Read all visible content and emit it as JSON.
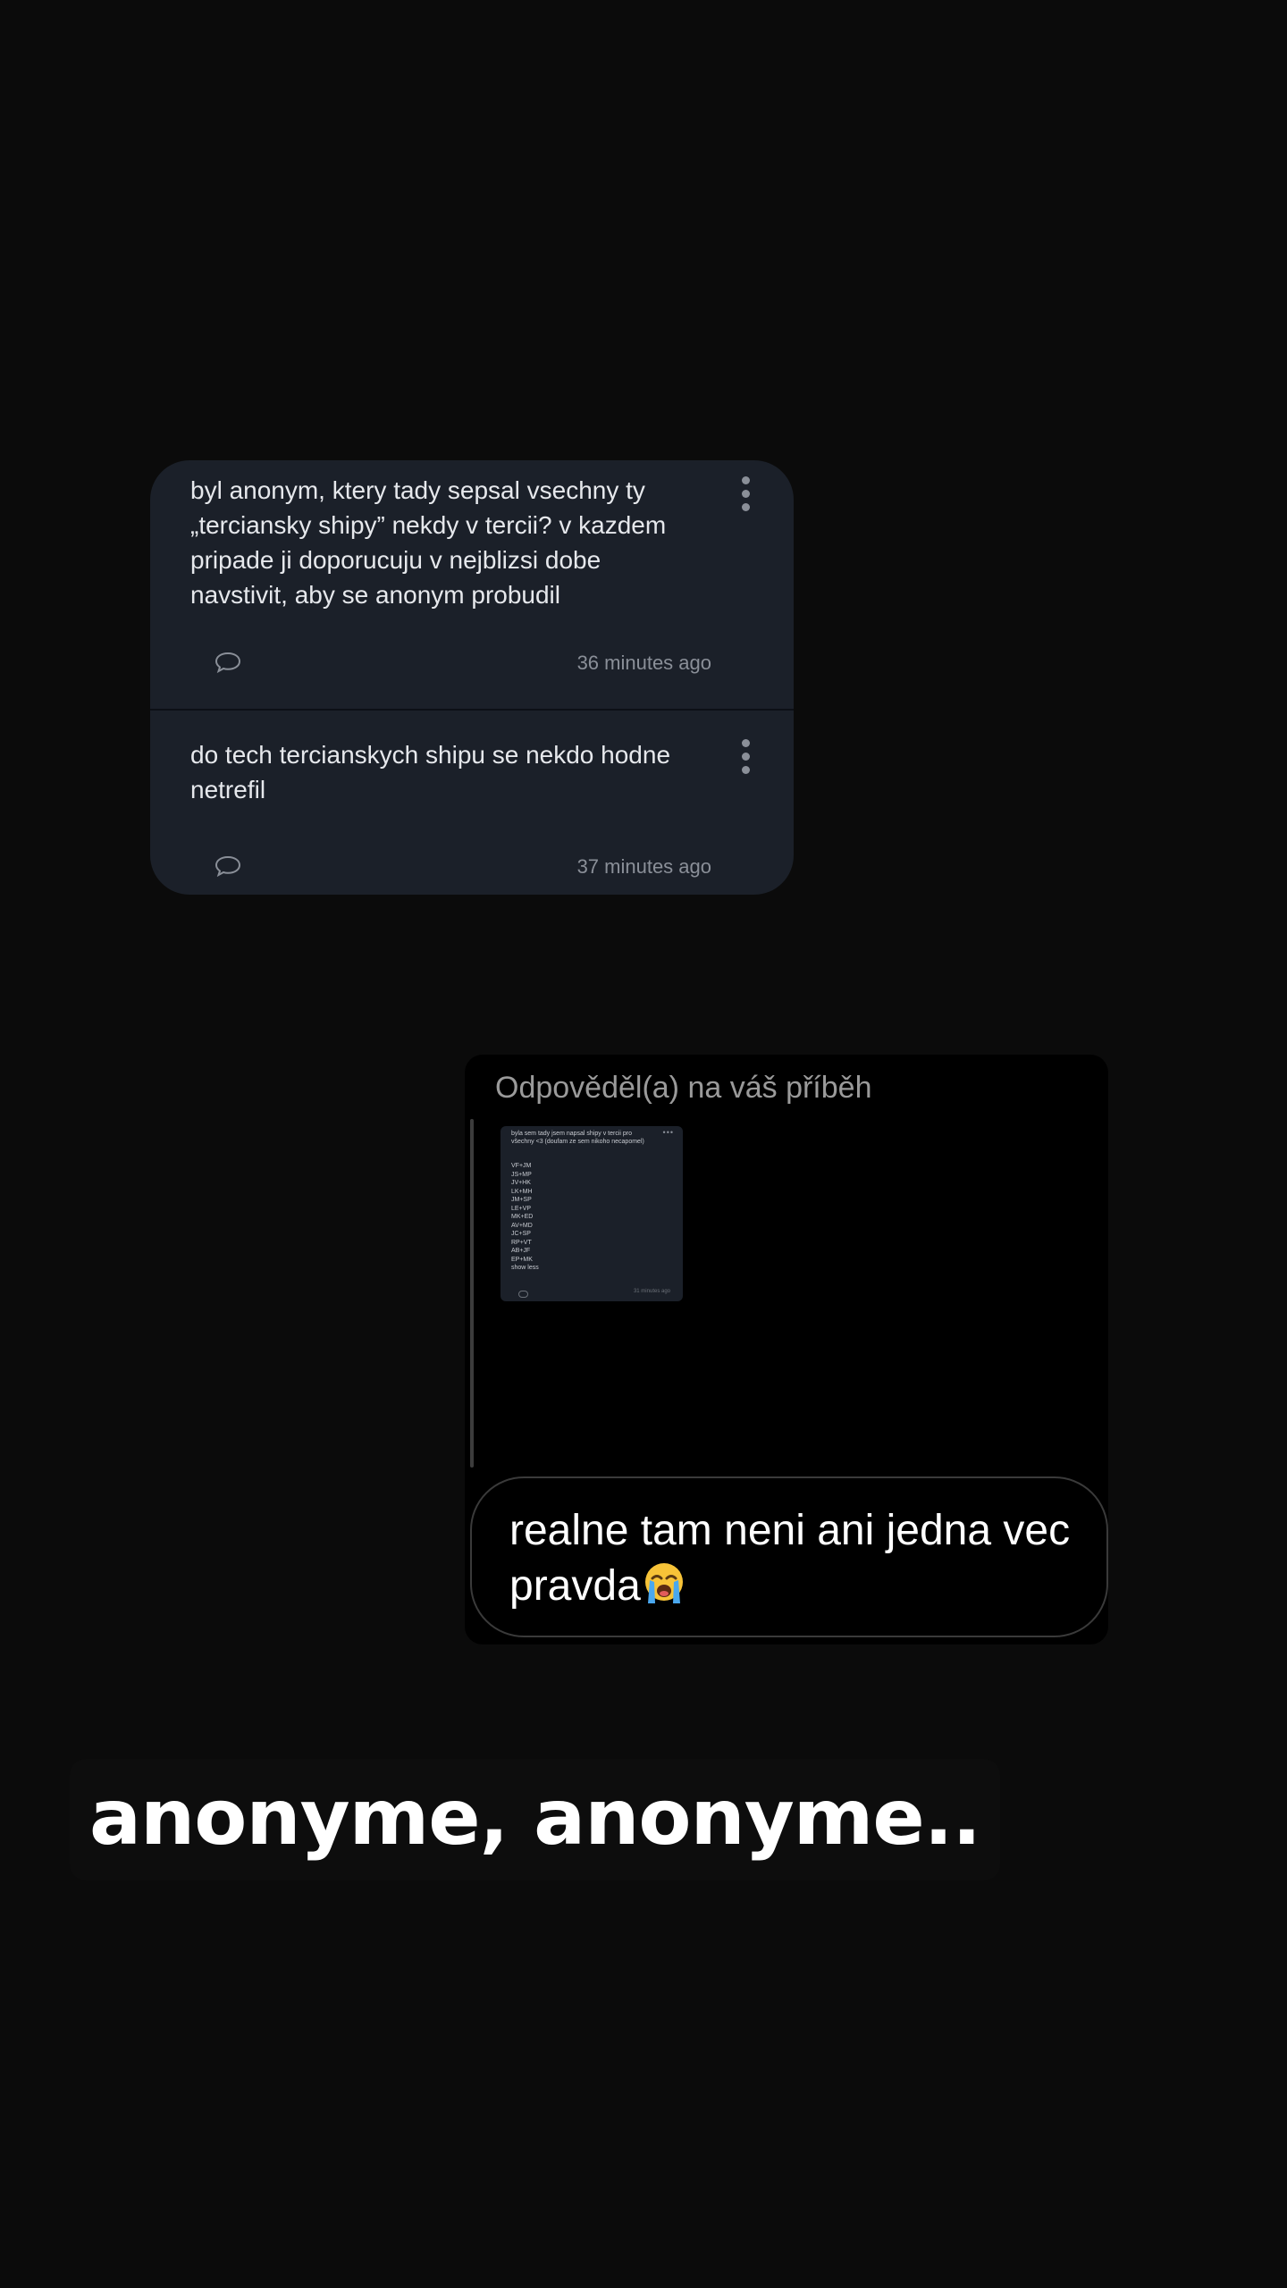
{
  "posts": [
    {
      "text": "byl anonym, ktery tady sepsal vsechny ty „terciansky shipy” nekdy v tercii? v kazdem pripade ji doporucuju v nejblizsi dobe navstivit, aby se anonym probudil",
      "time": "36 minutes ago"
    },
    {
      "text": "do tech tercianskych shipu se nekdo hodne netrefil",
      "time": "37 minutes ago"
    }
  ],
  "story_reply": {
    "caption": "Odpověděl(a) na váš příběh",
    "thumbnail": {
      "text": "byla sem tady jsem napsal shipy v tercii pro všechny <3 (doufam ze sem nikoho necapomel)",
      "pairs": [
        "VF+JM",
        "JS+MP",
        "JV+HK",
        "LK+MH",
        "JM+SP",
        "LE+VP",
        "MK+ED",
        "AV+MD",
        "JC+SP",
        "RP+VT",
        "AB+JF",
        "EP+MK",
        "show less"
      ],
      "time": "31 minutes ago"
    },
    "message": "realne tam neni ani jedna vec pravda",
    "emoji": "loudly-crying-face"
  },
  "sticker_text": "anonyme, anonyme..",
  "colors": {
    "background": "#0b0b0b",
    "card": "#1b2029",
    "muted": "#8a8f98",
    "reply_bg": "#000000"
  }
}
